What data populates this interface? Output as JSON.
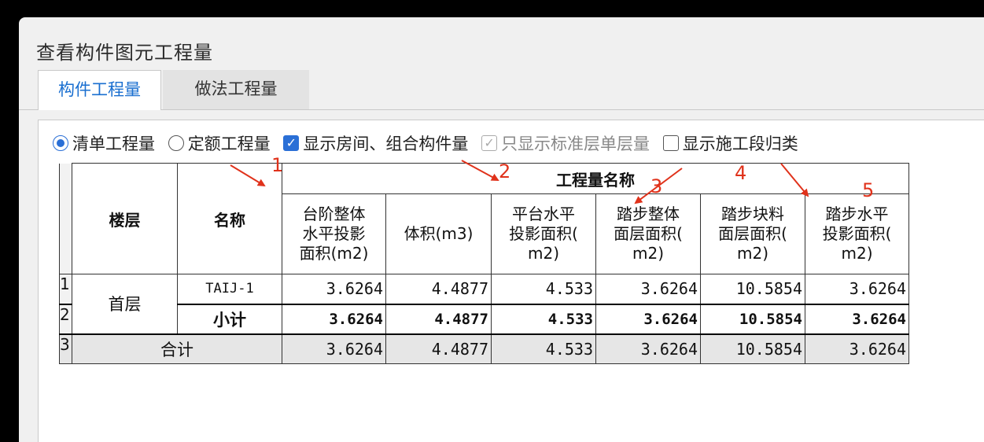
{
  "window_title": "查看构件图元工程量",
  "tabs": [
    {
      "label": "构件工程量",
      "active": true
    },
    {
      "label": "做法工程量",
      "active": false
    }
  ],
  "options": {
    "radio_bill": "清单工程量",
    "radio_quota": "定额工程量",
    "chk_room": "显示房间、组合构件量",
    "chk_std_floor": "只显示标准层单层量",
    "chk_stage": "显示施工段归类"
  },
  "table": {
    "group_header": "工程量名称",
    "col_floor": "楼层",
    "col_name": "名称",
    "col1": [
      "台阶整体",
      "水平投影",
      "面积(m2)"
    ],
    "col2": "体积(m3)",
    "col3": [
      "平台水平",
      "投影面积(",
      "m2)"
    ],
    "col4": [
      "踏步整体",
      "面层面积(",
      "m2)"
    ],
    "col5": [
      "踏步块料",
      "面层面积(",
      "m2)"
    ],
    "col6": [
      "踏步水平",
      "投影面积(",
      "m2)"
    ],
    "row_numbers": [
      "1",
      "2",
      "3"
    ],
    "floor_value": "首层",
    "row1": {
      "name": "TAIJ-1",
      "values": [
        "3.6264",
        "4.4877",
        "4.533",
        "3.6264",
        "10.5854",
        "3.6264"
      ]
    },
    "row2": {
      "name": "小计",
      "values": [
        "3.6264",
        "4.4877",
        "4.533",
        "3.6264",
        "10.5854",
        "3.6264"
      ]
    },
    "row3": {
      "name": "合计",
      "values": [
        "3.6264",
        "4.4877",
        "4.533",
        "3.6264",
        "10.5854",
        "3.6264"
      ]
    }
  },
  "annotations": [
    "1",
    "2",
    "3",
    "4",
    "5"
  ],
  "colors": {
    "accent": "#1a6fd0",
    "annotation": "#e0321b"
  }
}
